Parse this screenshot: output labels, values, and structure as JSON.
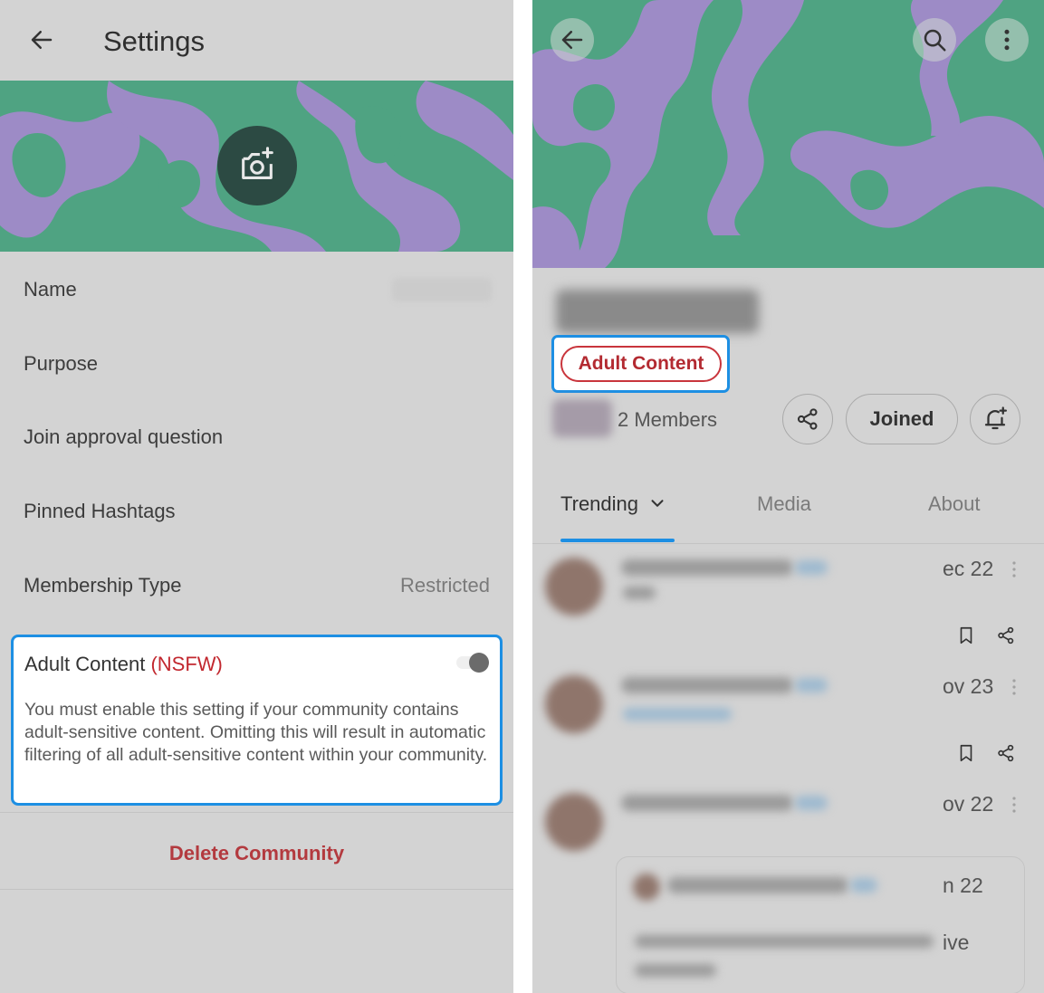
{
  "left": {
    "title": "Settings",
    "rows": [
      {
        "label": "Name"
      },
      {
        "label": "Purpose"
      },
      {
        "label": "Join approval question"
      },
      {
        "label": "Pinned Hashtags"
      },
      {
        "label": "Membership Type",
        "value": "Restricted"
      }
    ],
    "nsfw": {
      "label": "Adult Content",
      "tag": "(NSFW)",
      "description": "You must enable this setting if your community contains adult-sensitive content. Omitting this will result in automatic filtering of all adult-sensitive content within your community.",
      "enabled": true
    },
    "delete_label": "Delete Community"
  },
  "right": {
    "adult_badge": "Adult Content",
    "members": "2 Members",
    "joined_label": "Joined",
    "tabs": [
      {
        "label": "Trending",
        "active": true
      },
      {
        "label": "Media",
        "active": false
      },
      {
        "label": "About",
        "active": false
      }
    ],
    "posts": [
      {
        "date_fragment": "ec 22"
      },
      {
        "date_fragment": "ov 23"
      },
      {
        "date_fragment": "ov 22"
      }
    ],
    "quote": {
      "date_fragment": "n 22",
      "text_fragment": "ive"
    }
  },
  "colors": {
    "accent_blue": "#1d8fe3",
    "danger_red": "#c2282f",
    "banner_green": "#4fa382",
    "banner_purple": "#9d8bc6",
    "overlay_gray": "#d3d3d3"
  },
  "icons": [
    "back-arrow-icon",
    "camera-sparkle-icon",
    "search-icon",
    "more-vertical-icon",
    "share-icon",
    "bell-plus-icon",
    "chevron-down-icon",
    "bookmark-icon"
  ]
}
